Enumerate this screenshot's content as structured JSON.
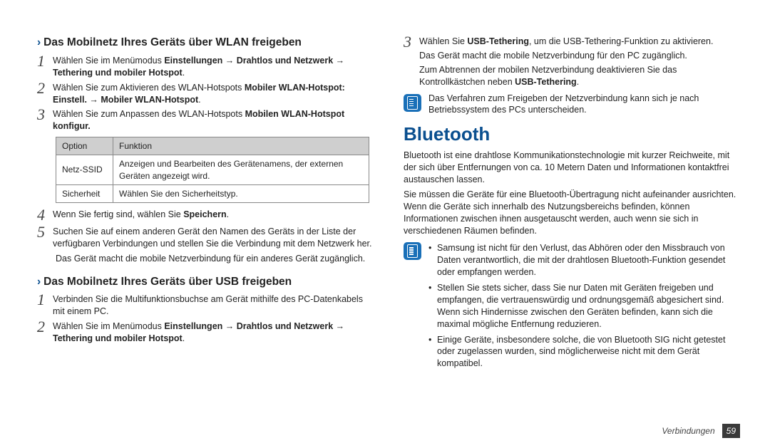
{
  "left": {
    "heading1": "Das Mobilnetz Ihres Geräts über WLAN freigeben",
    "s1": {
      "pre": "Wählen Sie im Menümodus ",
      "b1": "Einstellungen",
      "a1": " → ",
      "b2": "Drahtlos und Netzwerk",
      "a2": " → ",
      "b3": "Tethering und mobiler Hotspot",
      "post": "."
    },
    "s2": {
      "pre": "Wählen Sie zum Aktivieren des WLAN-Hotspots ",
      "b1": "Mobiler WLAN-Hotspot: Einstell.",
      "a1": " → ",
      "b2": "Mobiler WLAN-Hotspot",
      "post": "."
    },
    "s3": {
      "pre": "Wählen Sie zum Anpassen des WLAN-Hotspots ",
      "b1": "Mobilen WLAN-Hotspot konfigur.",
      "post": ""
    },
    "table": {
      "h1": "Option",
      "h2": "Funktion",
      "r1c1": "Netz-SSID",
      "r1c2": "Anzeigen und Bearbeiten des Gerätenamens, der externen Geräten angezeigt wird.",
      "r2c1": "Sicherheit",
      "r2c2": "Wählen Sie den Sicherheitstyp."
    },
    "s4": {
      "pre": "Wenn Sie fertig sind, wählen Sie ",
      "b1": "Speichern",
      "post": "."
    },
    "s5": "Suchen Sie auf einem anderen Gerät den Namen des Geräts in der Liste der verfügbaren Verbindungen und stellen Sie die Verbindung mit dem Netzwerk her.",
    "s5after": "Das Gerät macht die mobile Netzverbindung für ein anderes Gerät zugänglich.",
    "heading2": "Das Mobilnetz Ihres Geräts über USB freigeben",
    "u1": "Verbinden Sie die Multifunktionsbuchse am Gerät mithilfe des PC-Datenkabels mit einem PC.",
    "u2": {
      "pre": "Wählen Sie im Menümodus ",
      "b1": "Einstellungen",
      "a1": " → ",
      "b2": "Drahtlos und Netzwerk",
      "a2": " → ",
      "b3": "Tethering und mobiler Hotspot",
      "post": "."
    }
  },
  "right": {
    "u3": {
      "pre": "Wählen Sie ",
      "b1": "USB-Tethering",
      "post": ", um die USB-Tethering-Funktion zu aktivieren."
    },
    "u3a": "Das Gerät macht die mobile Netzverbindung für den PC zugänglich.",
    "u3b_pre": "Zum Abtrennen der mobilen Netzverbindung deaktivieren Sie das Kontrollkästchen neben ",
    "u3b_b": "USB-Tethering",
    "u3b_post": ".",
    "note1": "Das Verfahren zum Freigeben der Netzverbindung kann sich je nach Betriebssystem des PCs unterscheiden.",
    "bluetooth_title": "Bluetooth",
    "bt_p1": "Bluetooth ist eine drahtlose Kommunikationstechnologie mit kurzer Reichweite, mit der sich über Entfernungen von ca. 10 Metern Daten und Informationen kontaktfrei austauschen lassen.",
    "bt_p2": "Sie müssen die Geräte für eine Bluetooth-Übertragung nicht aufeinander ausrichten. Wenn die Geräte sich innerhalb des Nutzungsbereichs befinden, können Informationen zwischen ihnen ausgetauscht werden, auch wenn sie sich in verschiedenen Räumen befinden.",
    "bt_notes": [
      "Samsung ist nicht für den Verlust, das Abhören oder den Missbrauch von Daten verantwortlich, die mit der drahtlosen Bluetooth-Funktion gesendet oder empfangen werden.",
      "Stellen Sie stets sicher, dass Sie nur Daten mit Geräten freigeben und empfangen, die vertrauenswürdig und ordnungsgemäß abgesichert sind. Wenn sich Hindernisse zwischen den Geräten befinden, kann sich die maximal mögliche Entfernung reduzieren.",
      "Einige Geräte, insbesondere solche, die von Bluetooth SIG nicht getestet oder zugelassen wurden, sind möglicherweise nicht mit dem Gerät kompatibel."
    ]
  },
  "footer": {
    "section": "Verbindungen",
    "page": "59"
  }
}
